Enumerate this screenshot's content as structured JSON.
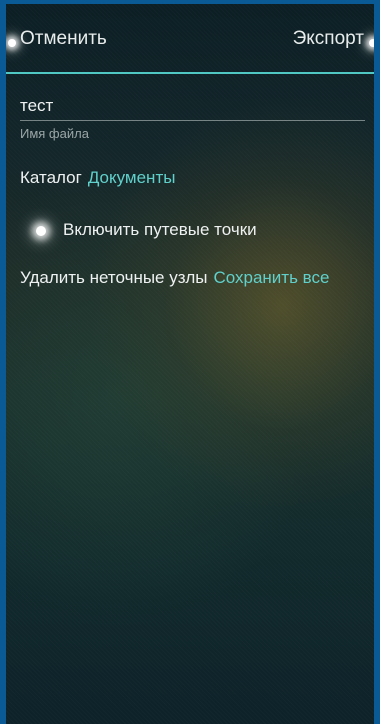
{
  "topbar": {
    "cancel_label": "Отменить",
    "export_label": "Экспорт"
  },
  "filename": {
    "value": "тест",
    "hint": "Имя файла"
  },
  "catalog": {
    "label": "Каталог",
    "value": "Документы"
  },
  "waypoints": {
    "label": "Включить путевые точки",
    "enabled": true
  },
  "remove_nodes": {
    "label": "Удалить неточные узлы",
    "value": "Сохранить все"
  },
  "colors": {
    "accent": "#5fd0cb",
    "divider": "#4fc7c2",
    "frame": "#0a5a96"
  }
}
